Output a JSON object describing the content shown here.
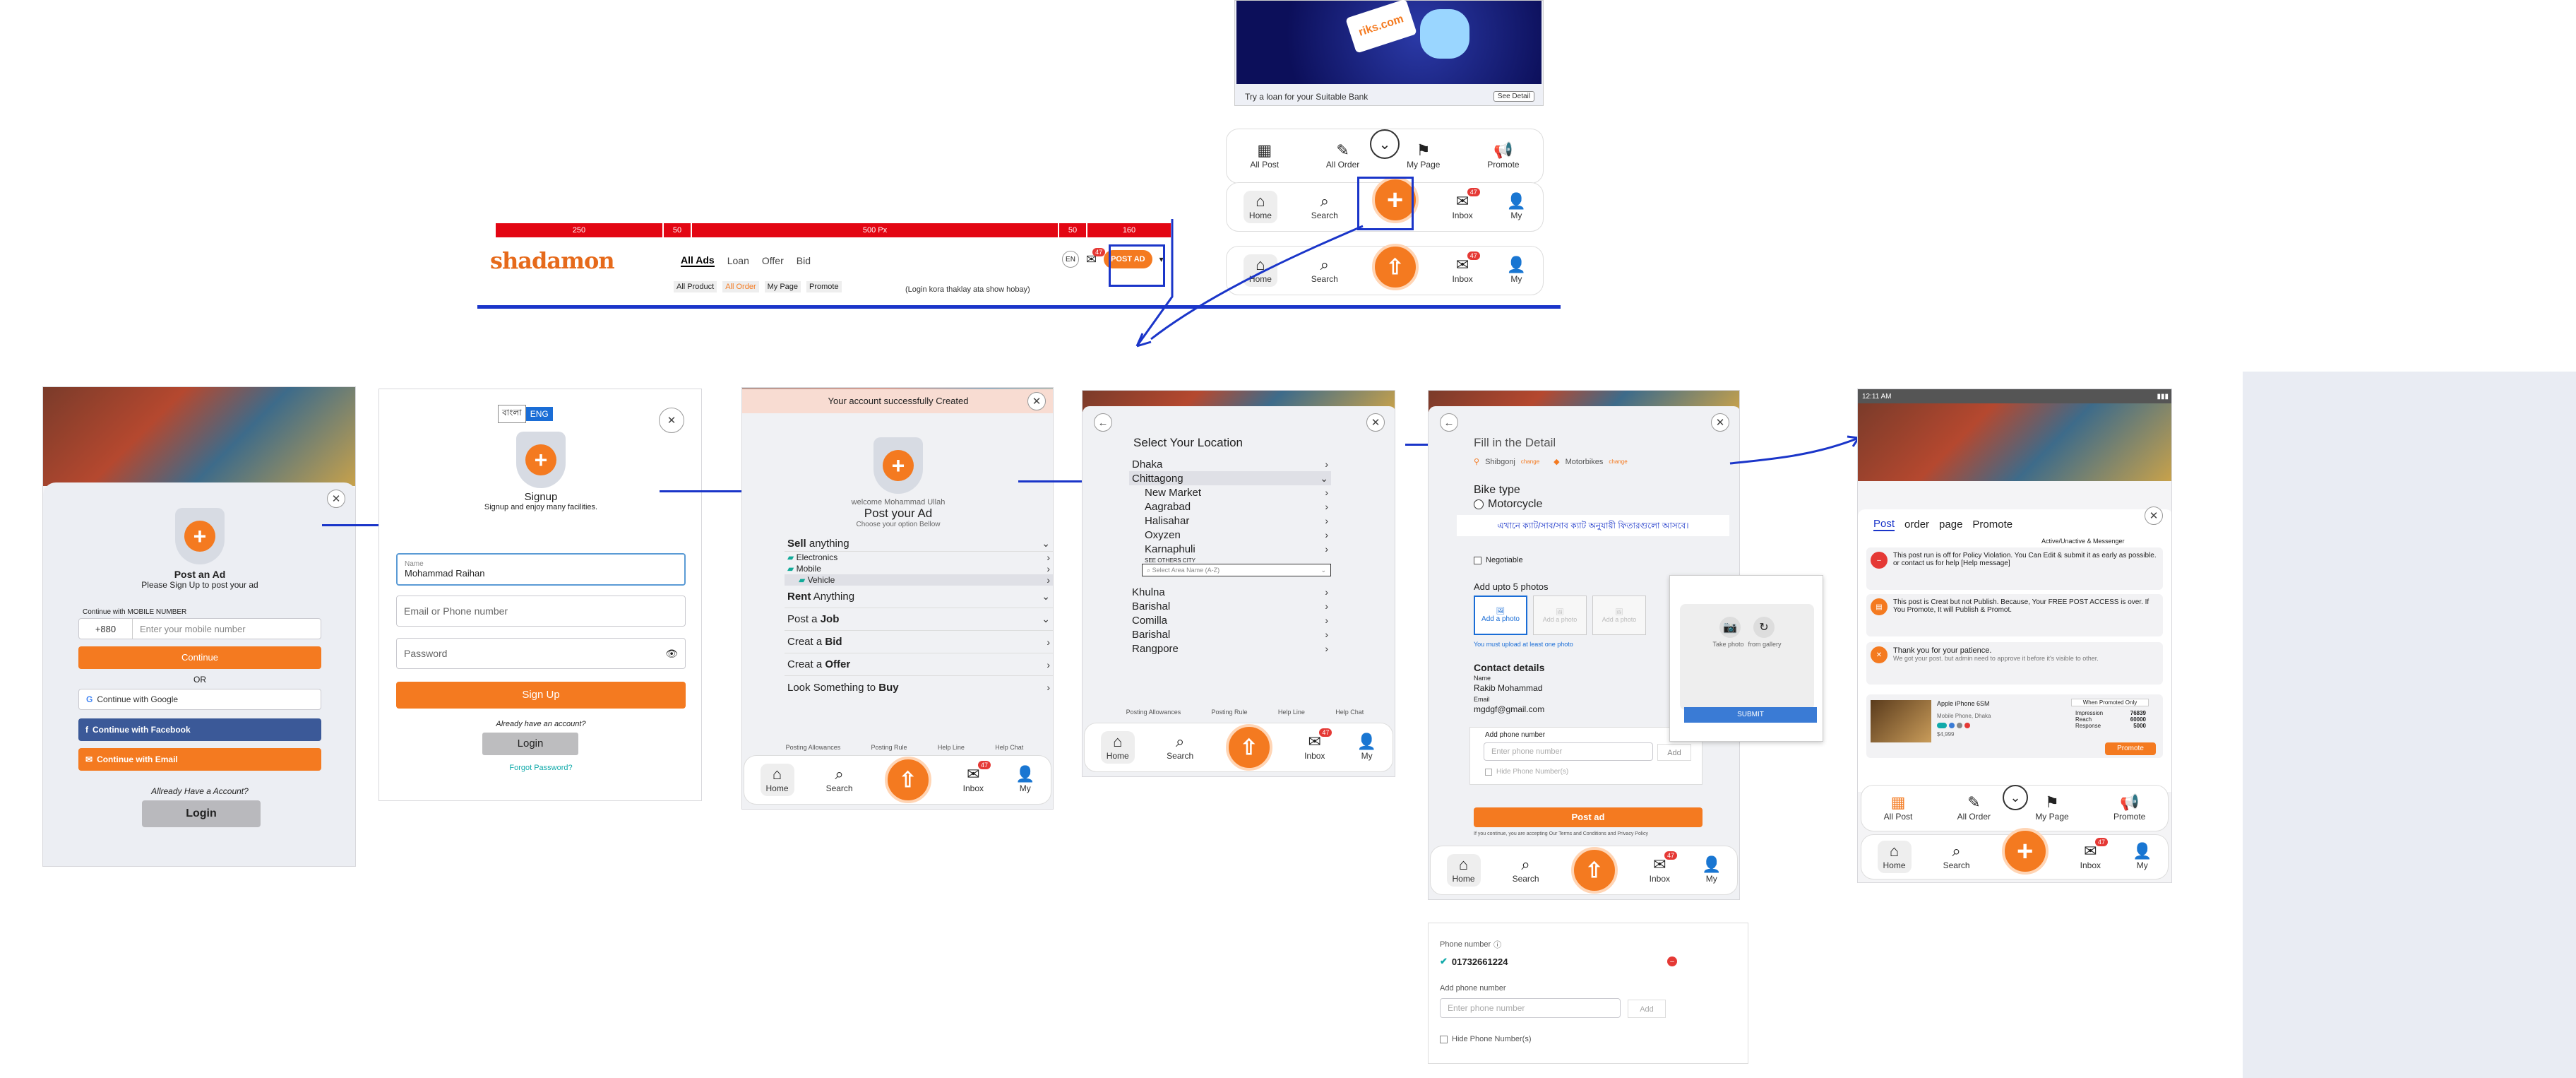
{
  "banner": {
    "loan_text": "Try a loan for your Suitable Bank",
    "see_detail": "See Detail",
    "brand_text": "riks.com"
  },
  "top_menu": {
    "items": [
      "All Post",
      "All Order",
      "My Page",
      "Promote"
    ]
  },
  "bottom_nav": {
    "home": "Home",
    "search": "Search",
    "inbox": "Inbox",
    "my": "My",
    "badge": "47"
  },
  "ruler": {
    "segments": [
      "250",
      "50",
      "500 Px",
      "50",
      "160"
    ]
  },
  "header": {
    "logo": "shadamon",
    "tabs": [
      "All Ads",
      "Loan",
      "Offer",
      "Bid"
    ],
    "lang": "EN",
    "post_ad": "POST AD",
    "subtabs": [
      "All Product",
      "All Order",
      "My Page",
      "Promote"
    ],
    "note": "(Login kora thaklay ata show hobay)"
  },
  "s1": {
    "title": "Post an Ad",
    "subtitle": "Please Sign Up to post your ad",
    "continue_label": "Continue with MOBILE NUMBER",
    "country_code": "+880",
    "mobile_placeholder": "Enter your mobile number",
    "continue": "Continue",
    "or": "OR",
    "google": "Continue with Google",
    "facebook": "Continue with Facebook",
    "email": "Continue with Email",
    "already": "Allready Have a Account?",
    "login": "Login"
  },
  "s2": {
    "lang_bn": "বাংলা",
    "lang_en": "ENG",
    "title": "Signup",
    "subtitle": "Signup and enjoy many facilities.",
    "name_label": "Name",
    "name_value": "Mohammad Raihan",
    "email_placeholder": "Email or Phone number",
    "password_placeholder": "Password",
    "signup": "Sign Up",
    "already": "Already have an account?",
    "login": "Login",
    "forgot": "Forgot Password?"
  },
  "s3": {
    "created": "Your account successfully Created",
    "welcome": "welcome Mohammad Ullah",
    "title": "Post your Ad",
    "subtitle": "Choose your option Bellow",
    "sell": "Sell",
    "sell_rest": "anything",
    "sub_items": [
      "Electronics",
      "Mobile",
      "Vehicle"
    ],
    "rent": "Rent",
    "rent_rest": "Anything",
    "job_pre": "Post a",
    "job": "Job",
    "bid_pre": "Creat a",
    "bid": "Bid",
    "offer_pre": "Creat a",
    "offer": "Offer",
    "buy_pre": "Look Something to",
    "buy": "Buy",
    "foot": [
      "Posting Allowances",
      "Posting Rule",
      "Help Line",
      "Help Chat"
    ]
  },
  "s4": {
    "title": "Select Your Location",
    "cities": [
      "Dhaka",
      "Chittagong"
    ],
    "areas": [
      "New Market",
      "Aagrabad",
      "Halisahar",
      "Oxyzen",
      "Karnaphuli"
    ],
    "see_other": "SEE OTHERS CITY",
    "search_placeholder": "Select Area Name (A-Z)",
    "more_cities": [
      "Khulna",
      "Barishal",
      "Comilla",
      "Barishal",
      "Rangpore"
    ],
    "foot": [
      "Posting Allowances",
      "Posting Rule",
      "Help Line",
      "Help Chat"
    ]
  },
  "s5": {
    "title": "Fill in the Detail",
    "loc": "Shibgonj",
    "loc_change": "change",
    "cat": "Motorbikes",
    "cat_change": "change",
    "bike_type": "Bike type",
    "motorcycle": "Motorcycle",
    "bangla_note": "এখানে ক্যাট/সাব/সাব ক্যাট অনুযায়ী ফিতারগুলো আসবে।",
    "negotiable": "Negotiable",
    "photos_title": "Add upto 5 photos",
    "add_photo": "Add a photo",
    "photo_warn": "You must upload at least one photo",
    "contact": "Contact details",
    "name_label": "Name",
    "name": "Rakib Mohammad",
    "email_label": "Email",
    "email": "mgdgf@gmail.com",
    "add_phone": "Add phone number",
    "phone_placeholder": "Enter phone number",
    "add": "Add",
    "hide_phone": "Hide Phone Number(s)",
    "post": "Post ad",
    "terms": "If you continue, you are accepting Our Terms and Conditions and Privacy Policy",
    "popup_take": "Take photo",
    "popup_gallery": "from gallery",
    "popup_submit": "SUBMIT"
  },
  "s5b": {
    "phone_label": "Phone number",
    "phone": "01732661224",
    "add_phone": "Add phone number",
    "placeholder": "Enter phone number",
    "add": "Add",
    "hide": "Hide Phone Number(s)"
  },
  "s6": {
    "time": "12:11 AM",
    "tabs": [
      "Post",
      "order",
      "page",
      "Promote"
    ],
    "status": "Active/Unactive & Messenger",
    "msg1": "This post run is off for Policy Violation. You Can Edit & submit it as early as possible. or contact us for help [Help message]",
    "msg2": "This post is Creat but not Publish. Because, Your FREE POST ACCESS is over. If You Promote, It will Publish & Promot.",
    "msg3": "Thank you for your patience.",
    "msg3b": "We got your post. but admin need to approve it before it's visible to other.",
    "product": "Apple iPhone 6SM",
    "product_sub": "Mobile Phone, Dhaka",
    "price": "$4,999",
    "when_promoted": "When Promoted Only",
    "stat_labels": [
      "Impression",
      "Reach",
      "Response"
    ],
    "stat_values": [
      "76839",
      "60000",
      "5000"
    ],
    "promote": "Promote"
  },
  "colors": {
    "accent": "#f47a20",
    "annotation": "#1a35c9",
    "facebook": "#3b5998"
  }
}
